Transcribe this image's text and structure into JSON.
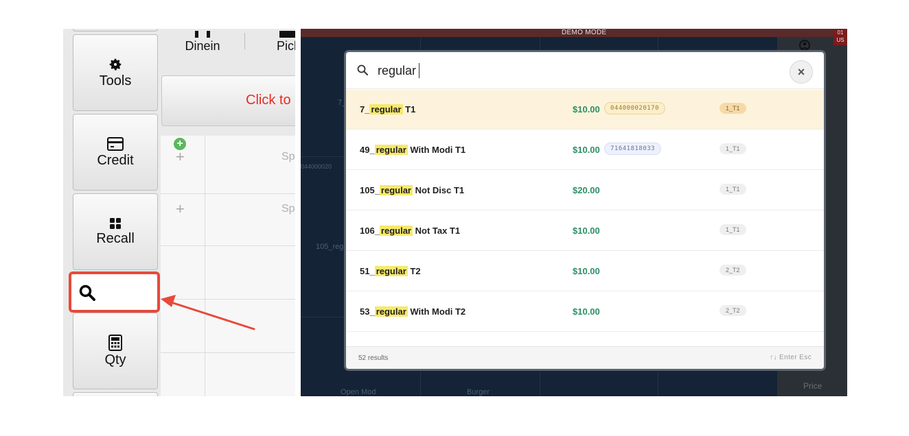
{
  "left_panel": {
    "order_types": [
      "Dinein",
      "Pick"
    ],
    "buttons": [
      {
        "label": "Tools",
        "icon": "gear-icon"
      },
      {
        "label": "Credit",
        "icon": "credit-card-icon"
      },
      {
        "label": "Recall",
        "icon": "grid-icon"
      },
      {
        "label": "Qty",
        "icon": "calculator-icon"
      }
    ],
    "banner_text": "Click to",
    "grid_labels": [
      "Sp",
      "Sp"
    ]
  },
  "pos_background": {
    "demo_mode": "DEMO MODE",
    "labels": [
      "7_",
      "044000020",
      "105_reg",
      "Open Mod",
      "Burger"
    ],
    "right_strip_labels": [
      "Price"
    ],
    "badge": "01\nUS"
  },
  "search_modal": {
    "query": "regular",
    "close_icon": "close-icon",
    "results": [
      {
        "pre": "7_",
        "highlight": "regular",
        "post": " T1",
        "price": "$10.00",
        "code": "044000020170",
        "category": "1_T1",
        "active": true
      },
      {
        "pre": "49_",
        "highlight": "regular",
        "post": " With Modi T1",
        "price": "$10.00",
        "code": "71641818033",
        "category": "1_T1",
        "active": false
      },
      {
        "pre": "105_",
        "highlight": "regular",
        "post": " Not Disc T1",
        "price": "$20.00",
        "code": "",
        "category": "1_T1",
        "active": false
      },
      {
        "pre": "106_",
        "highlight": "regular",
        "post": " Not Tax T1",
        "price": "$10.00",
        "code": "",
        "category": "1_T1",
        "active": false
      },
      {
        "pre": "51_",
        "highlight": "regular",
        "post": " T2",
        "price": "$10.00",
        "code": "",
        "category": "2_T2",
        "active": false
      },
      {
        "pre": "53_",
        "highlight": "regular",
        "post": " With Modi T2",
        "price": "$10.00",
        "code": "",
        "category": "2_T2",
        "active": false
      }
    ],
    "results_count": "52 results",
    "keyboard_hint": "↑↓ Enter Esc"
  },
  "colors": {
    "highlight": "#f7e96b",
    "price_green": "#2e8f66",
    "active_row": "#fdf3dc",
    "annotation_red": "#e8493a"
  }
}
